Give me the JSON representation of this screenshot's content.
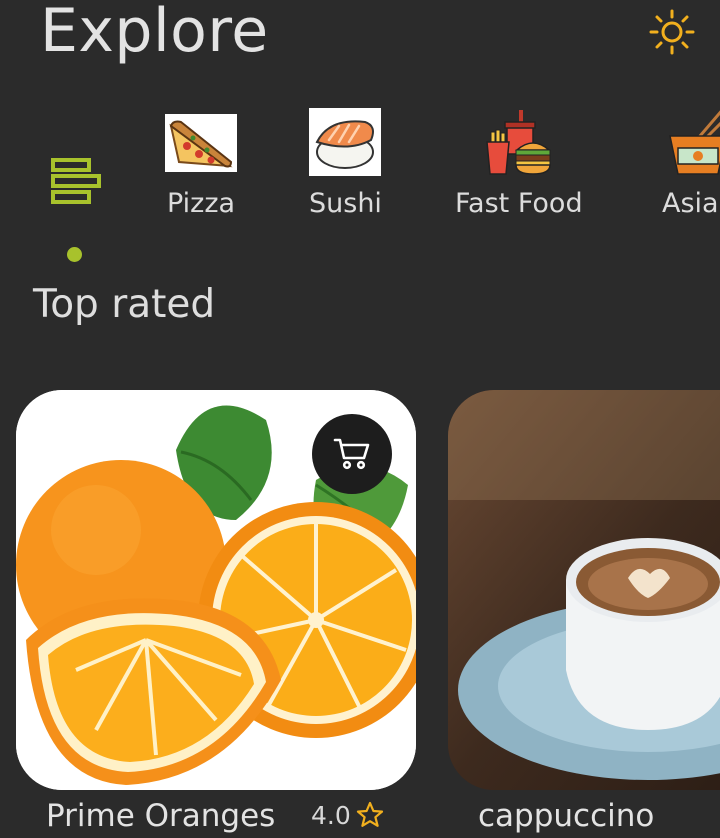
{
  "header": {
    "title": "Explore",
    "theme_icon": "sun-icon"
  },
  "categories": [
    {
      "label": "Pizza",
      "icon": "pizza-icon"
    },
    {
      "label": "Sushi",
      "icon": "sushi-icon"
    },
    {
      "label": "Fast Food",
      "icon": "fast-food-icon"
    },
    {
      "label": "Asia",
      "icon": "asian-noodles-icon"
    }
  ],
  "section": {
    "title": "Top rated"
  },
  "products": [
    {
      "name": "Prime Oranges",
      "rating": "4.0",
      "image": "oranges-photo"
    },
    {
      "name": "cappuccino",
      "image": "cappuccino-photo"
    }
  ],
  "colors": {
    "background": "#2b2b2b",
    "accent": "#a8c22c",
    "sun": "#f2b01e",
    "cart_button": "#1d1d1d"
  }
}
